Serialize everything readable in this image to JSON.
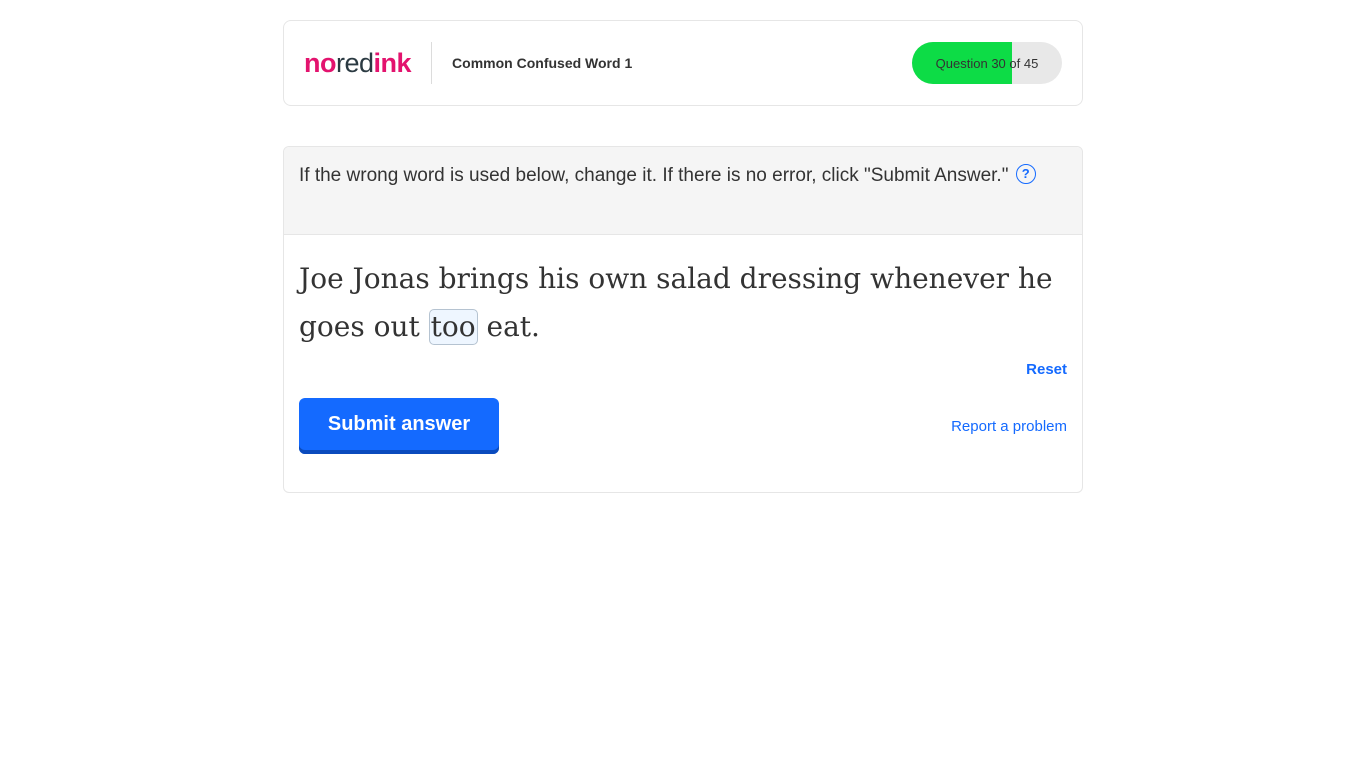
{
  "header": {
    "logo": {
      "part1": "no",
      "part2": "red",
      "part3": "ink"
    },
    "activity_title": "Common Confused Word 1",
    "progress": {
      "label": "Question 30 of 45",
      "current": 30,
      "total": 45,
      "fill_color": "#0ddc46"
    }
  },
  "question": {
    "instructions": "If the wrong word is used below, change it. If there is no error, click \"Submit Answer.\"",
    "help_icon": "question-mark-circle-icon",
    "help_glyph": "?",
    "sentence_before": "Joe Jonas brings his own salad dressing whenever he goes out ",
    "editable_word": "too",
    "sentence_after": " eat."
  },
  "controls": {
    "reset_label": "Reset",
    "submit_label": "Submit answer",
    "report_label": "Report a problem"
  },
  "colors": {
    "brand_pink": "#e3136e",
    "primary_blue": "#146aff",
    "progress_green": "#0ddc46"
  }
}
